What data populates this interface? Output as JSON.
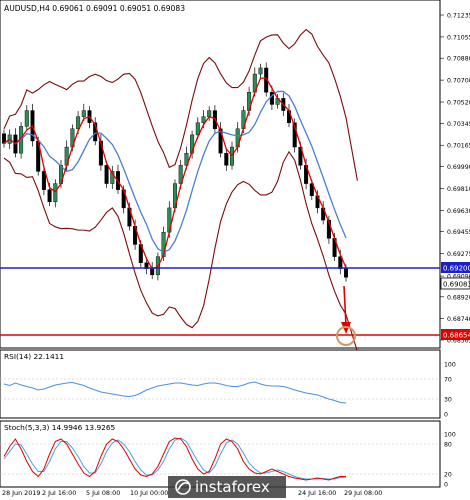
{
  "symbol_header": "AUDUSD,H4  0.69061 0.69091 0.69051 0.69083",
  "watermark": "instaforex",
  "colors": {
    "bull": "#2e8b57",
    "bear": "#000000",
    "ma_fast": "#e00000",
    "ma_slow": "#4a7fd0",
    "bollinger": "#7b0c0c",
    "level_blue": "#1c20c8",
    "level_red": "#e00000",
    "rsi": "#4a90e2",
    "stoch_main": "#e00000",
    "stoch_signal": "#4aa3df"
  },
  "price_panel": {
    "y_ticks": [
      "0.71235",
      "0.71055",
      "0.70880",
      "0.70700",
      "0.70520",
      "0.70345",
      "0.70165",
      "0.69990",
      "0.69810",
      "0.69630",
      "0.69455",
      "0.69275",
      "0.69090",
      "0.68920",
      "0.68740",
      "0.68565"
    ],
    "current_price_label": "0.69083",
    "blue_level_label": "0.69200",
    "red_level_label": "0.68654"
  },
  "rsi_panel": {
    "label": "RSI(14) 22.1411",
    "y_ticks": [
      "100",
      "70",
      "30",
      "0"
    ]
  },
  "stoch_panel": {
    "label": "Stoch(5,3,3) 14.9946 13.9265",
    "y_ticks": [
      "100",
      "80",
      "20",
      "0"
    ]
  },
  "x_axis_labels": [
    "28 Jun 2019",
    "2 Jul 16:00",
    "5 Jul 08:00",
    "10 Jul 00:00",
    "24 Jul 16:00",
    "29 Jul 08:00"
  ],
  "chart_data": {
    "type": "candlestick",
    "symbol": "AUDUSD",
    "timeframe": "H4",
    "ohlc_latest": {
      "open": 0.69061,
      "high": 0.69091,
      "low": 0.69051,
      "close": 0.69083
    },
    "levels": {
      "blue": 0.692,
      "red": 0.68654,
      "current": 0.69083
    },
    "rsi_latest": 22.1411,
    "stoch_latest": {
      "main": 14.9946,
      "signal": 13.9265
    },
    "closes": [
      0.7018,
      0.7025,
      0.701,
      0.7032,
      0.7045,
      0.702,
      0.6995,
      0.698,
      0.697,
      0.6985,
      0.7,
      0.7015,
      0.703,
      0.704,
      0.7045,
      0.7035,
      0.702,
      0.7,
      0.6985,
      0.6995,
      0.698,
      0.6965,
      0.695,
      0.6935,
      0.692,
      0.6915,
      0.691,
      0.6925,
      0.6945,
      0.6965,
      0.6985,
      0.7,
      0.701,
      0.7025,
      0.7035,
      0.704,
      0.7045,
      0.703,
      0.701,
      0.7,
      0.7015,
      0.703,
      0.7045,
      0.706,
      0.7075,
      0.708,
      0.706,
      0.705,
      0.7055,
      0.7045,
      0.7035,
      0.7015,
      0.7,
      0.6985,
      0.6975,
      0.6965,
      0.6955,
      0.694,
      0.6925,
      0.6915,
      0.6908
    ],
    "rsi": [
      60,
      57,
      62,
      58,
      55,
      52,
      48,
      50,
      54,
      58,
      60,
      62,
      63,
      60,
      57,
      52,
      48,
      44,
      42,
      40,
      38,
      36,
      35,
      37,
      42,
      48,
      52,
      56,
      58,
      60,
      62,
      62,
      60,
      58,
      57,
      60,
      62,
      62,
      60,
      57,
      55,
      55,
      58,
      62,
      64,
      60,
      57,
      56,
      56,
      55,
      52,
      48,
      45,
      42,
      40,
      38,
      34,
      30,
      27,
      23,
      22
    ],
    "stoch_main": [
      55,
      75,
      90,
      70,
      45,
      25,
      15,
      30,
      60,
      85,
      90,
      80,
      60,
      40,
      22,
      15,
      25,
      55,
      80,
      90,
      85,
      70,
      50,
      30,
      18,
      15,
      20,
      35,
      60,
      85,
      92,
      90,
      75,
      50,
      30,
      20,
      25,
      50,
      80,
      90,
      85,
      70,
      45,
      30,
      22,
      20,
      25,
      30,
      25,
      20,
      15,
      12,
      10,
      8,
      10,
      12,
      10,
      8,
      12,
      15,
      15
    ],
    "stoch_signal": [
      50,
      65,
      80,
      78,
      60,
      40,
      25,
      25,
      45,
      70,
      85,
      85,
      72,
      55,
      35,
      22,
      22,
      40,
      65,
      82,
      88,
      80,
      65,
      45,
      28,
      18,
      18,
      28,
      45,
      70,
      88,
      92,
      85,
      65,
      45,
      28,
      22,
      35,
      60,
      82,
      88,
      80,
      62,
      42,
      30,
      22,
      22,
      25,
      28,
      25,
      20,
      15,
      12,
      10,
      10,
      10,
      11,
      10,
      10,
      13,
      14
    ]
  }
}
